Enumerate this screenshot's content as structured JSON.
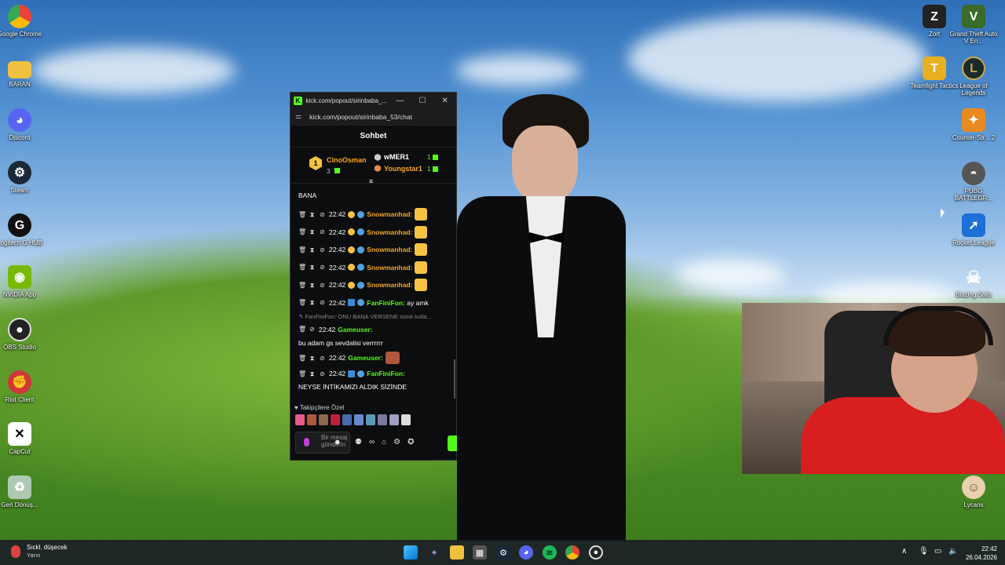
{
  "desktop_left": [
    {
      "label": "Google Chrome",
      "icon": "chrome-icon"
    },
    {
      "label": "BARAN",
      "icon": "folder-icon"
    },
    {
      "label": "Discord",
      "icon": "discord-icon"
    },
    {
      "label": "Steam",
      "icon": "steam-icon"
    },
    {
      "label": "Logitech G HUB",
      "icon": "logitech-icon"
    },
    {
      "label": "NVIDIA App",
      "icon": "nvidia-icon"
    },
    {
      "label": "OBS Studio",
      "icon": "obs-icon"
    },
    {
      "label": "Riot Client",
      "icon": "riot-icon"
    },
    {
      "label": "CapCut",
      "icon": "capcut-icon"
    },
    {
      "label": "Geri Dönüş...",
      "icon": "recycle-bin-icon"
    }
  ],
  "desktop_right": [
    {
      "label": "Zort",
      "icon": "zort-icon"
    },
    {
      "label": "Grand Theft Auto V En...",
      "icon": "gta-icon"
    },
    {
      "label": "Teamfight Tactics",
      "icon": "tft-icon"
    },
    {
      "label": "League of Legends",
      "icon": "lol-icon"
    },
    {
      "label": "Counter-Str... 2",
      "icon": "cs2-icon"
    },
    {
      "label": "PUBG BATTLEGR...",
      "icon": "pubg-icon"
    },
    {
      "label": "Rocket League",
      "icon": "rocket-league-icon"
    },
    {
      "label": "Blazing Sails",
      "icon": "blazing-sails-icon"
    },
    {
      "label": "Lycans",
      "icon": "lycans-icon"
    }
  ],
  "popup": {
    "tab_title": "kick.com/popout/sirinbaba_...",
    "url": "kick.com/popout/sirinbaba_53/chat",
    "chat_header": "Sohbet",
    "leaderboard": {
      "first": {
        "rank": "1",
        "name": "CinoOsman",
        "count": "3"
      },
      "second": {
        "name": "wMER1",
        "count": "1"
      },
      "third": {
        "name": "Youngstar1",
        "count": "1"
      }
    },
    "messages": [
      {
        "time": "",
        "user": "",
        "text": "BANA",
        "user_color": "orange",
        "emote": false
      },
      {
        "time": "22:42",
        "user": "Snowmanhad:",
        "text": "",
        "user_color": "orange",
        "emote": true
      },
      {
        "time": "22:42",
        "user": "Snowmanhad:",
        "text": "",
        "user_color": "orange",
        "emote": true
      },
      {
        "time": "22:42",
        "user": "Snowmanhad:",
        "text": "",
        "user_color": "orange",
        "emote": true
      },
      {
        "time": "22:42",
        "user": "Snowmanhad:",
        "text": "",
        "user_color": "orange",
        "emote": true
      },
      {
        "time": "22:42",
        "user": "Snowmanhad:",
        "text": "",
        "user_color": "orange",
        "emote": true
      },
      {
        "time": "22:42",
        "user": "FanFiniFon:",
        "text": "ay amk",
        "user_color": "green",
        "emote": false
      }
    ],
    "reply_preview": "FanFiniFon: ONU BANA VERSENE isimli kulla...",
    "messages2": [
      {
        "time": "22:42",
        "user": "Gameuser:",
        "text": "bu adam gs sevdalisi verrrrrr",
        "user_color": "green"
      },
      {
        "time": "22:42",
        "user": "Gameuser:",
        "text": "",
        "user_color": "green"
      },
      {
        "time": "22:42",
        "user": "FanFiniFon:",
        "text": "NEYSE İNTİKAMIZI ALDIK SİZİNDE",
        "user_color": "green"
      }
    ],
    "followers_label": "Takipçilere Özel",
    "input_placeholder": "Bir mesaj gönderin"
  },
  "taskbar": {
    "weather_title": "Sıckl. düşecek",
    "weather_sub": "Yarın",
    "time": "22:42",
    "date": "26.04.2026"
  }
}
